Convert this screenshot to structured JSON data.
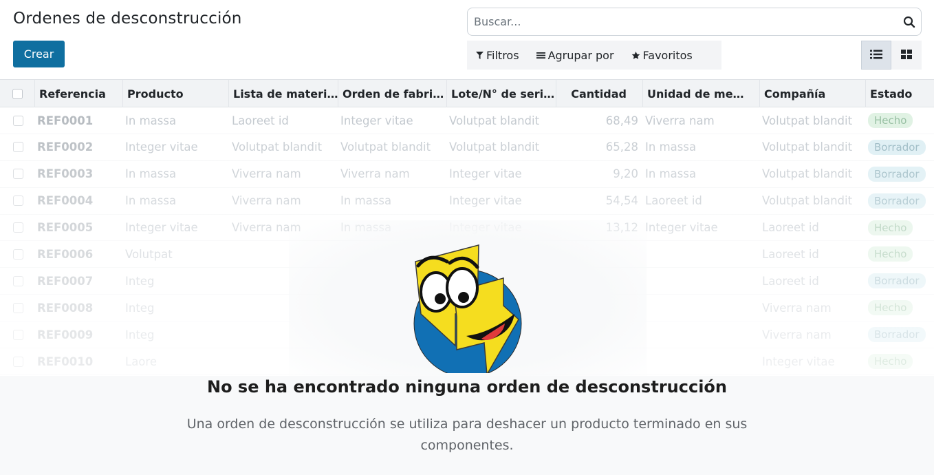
{
  "page": {
    "title": "Ordenes de desconstrucción",
    "create_label": "Crear"
  },
  "search": {
    "placeholder": "Buscar..."
  },
  "filters": {
    "filters_label": "Filtros",
    "group_by_label": "Agrupar por",
    "favorites_label": "Favoritos"
  },
  "view_switcher": {
    "options": [
      "list-view",
      "kanban-view"
    ],
    "active": "list-view"
  },
  "table": {
    "columns": [
      "Referencia",
      "Producto",
      "Lista de materi…",
      "Orden de fabri…",
      "Lote/N° de seri…",
      "Cantidad",
      "Unidad de me…",
      "Compañía",
      "Estado"
    ],
    "rows": [
      {
        "ref": "REF0001",
        "producto": "In massa",
        "lista": "Laoreet id",
        "orden": "Integer vitae",
        "lote": "Volutpat blandit",
        "cantidad": "68,49",
        "unidad": "Viverra nam",
        "compania": "Volutpat blandit",
        "estado": "Hecho",
        "estado_kind": "done"
      },
      {
        "ref": "REF0002",
        "producto": "Integer vitae",
        "lista": "Volutpat blandit",
        "orden": "Volutpat blandit",
        "lote": "Volutpat blandit",
        "cantidad": "65,28",
        "unidad": "In massa",
        "compania": "Volutpat blandit",
        "estado": "Borrador",
        "estado_kind": "draft"
      },
      {
        "ref": "REF0003",
        "producto": "In massa",
        "lista": "Viverra nam",
        "orden": "Viverra nam",
        "lote": "Integer vitae",
        "cantidad": "9,20",
        "unidad": "In massa",
        "compania": "Volutpat blandit",
        "estado": "Borrador",
        "estado_kind": "draft"
      },
      {
        "ref": "REF0004",
        "producto": "In massa",
        "lista": "Viverra nam",
        "orden": "In massa",
        "lote": "Integer vitae",
        "cantidad": "54,54",
        "unidad": "Laoreet id",
        "compania": "Volutpat blandit",
        "estado": "Borrador",
        "estado_kind": "draft"
      },
      {
        "ref": "REF0005",
        "producto": "Integer vitae",
        "lista": "Viverra nam",
        "orden": "In massa",
        "lote": "Integer vitae",
        "cantidad": "13,12",
        "unidad": "Integer vitae",
        "compania": "Laoreet id",
        "estado": "Hecho",
        "estado_kind": "done"
      },
      {
        "ref": "REF0006",
        "producto": "Volutpat",
        "lista": "",
        "orden": "",
        "lote": "",
        "cantidad": "",
        "unidad": "",
        "compania": "Laoreet id",
        "estado": "Hecho",
        "estado_kind": "done"
      },
      {
        "ref": "REF0007",
        "producto": "Integ",
        "lista": "",
        "orden": "",
        "lote": "",
        "cantidad": "",
        "unidad": "",
        "compania": "Laoreet id",
        "estado": "Borrador",
        "estado_kind": "draft"
      },
      {
        "ref": "REF0008",
        "producto": "Integ",
        "lista": "",
        "orden": "",
        "lote": "",
        "cantidad": "",
        "unidad": "",
        "compania": "Viverra nam",
        "estado": "Hecho",
        "estado_kind": "done"
      },
      {
        "ref": "REF0009",
        "producto": "Integ",
        "lista": "",
        "orden": "",
        "lote": "",
        "cantidad": "",
        "unidad": "",
        "compania": "Viverra nam",
        "estado": "Borrador",
        "estado_kind": "draft"
      },
      {
        "ref": "REF0010",
        "producto": "Laore",
        "lista": "",
        "orden": "",
        "lote": "",
        "cantidad": "",
        "unidad": "",
        "compania": "Integer vitae",
        "estado": "Hecho",
        "estado_kind": "done"
      }
    ]
  },
  "empty_state": {
    "title": "No se ha encontrado ninguna orden de desconstrucción",
    "text": "Una orden de desconstrucción se utiliza para deshacer un producto terminado en sus componentes."
  },
  "colors": {
    "primary": "#0f6fa0",
    "badge_done": "#d4edd9",
    "badge_draft": "#cfe8ef",
    "mascot_blue": "#1170b4",
    "mascot_yellow": "#f5dd1f"
  }
}
